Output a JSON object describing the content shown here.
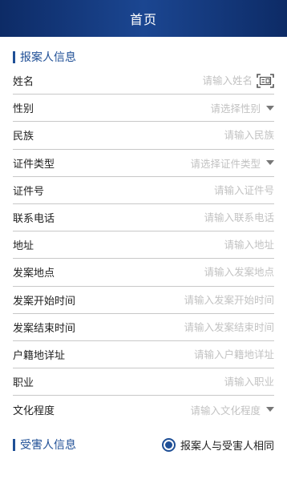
{
  "header": {
    "title": "首页"
  },
  "sections": {
    "reporter": "报案人信息",
    "victim": "受害人信息"
  },
  "fields": {
    "name": {
      "label": "姓名",
      "placeholder": "请输入姓名",
      "value": ""
    },
    "gender": {
      "label": "性别",
      "placeholder": "请选择性别"
    },
    "ethnicity": {
      "label": "民族",
      "placeholder": "请输入民族",
      "value": ""
    },
    "id_type": {
      "label": "证件类型",
      "placeholder": "请选择证件类型"
    },
    "id_number": {
      "label": "证件号",
      "placeholder": "请输入证件号",
      "value": ""
    },
    "phone": {
      "label": "联系电话",
      "placeholder": "请输入联系电话",
      "value": ""
    },
    "address": {
      "label": "地址",
      "placeholder": "请输入地址",
      "value": ""
    },
    "incident_place": {
      "label": "发案地点",
      "placeholder": "请输入发案地点",
      "value": ""
    },
    "start_time": {
      "label": "发案开始时间",
      "placeholder": "请输入发案开始时间",
      "value": ""
    },
    "end_time": {
      "label": "发案结束时间",
      "placeholder": "请输入发案结束时间",
      "value": ""
    },
    "household": {
      "label": "户籍地详址",
      "placeholder": "请输入户籍地详址",
      "value": ""
    },
    "occupation": {
      "label": "职业",
      "placeholder": "请输入职业",
      "value": ""
    },
    "education": {
      "label": "文化程度",
      "placeholder": "请输入文化程度"
    }
  },
  "same_as_reporter": {
    "label": "报案人与受害人相同",
    "checked": true
  },
  "icons": {
    "scan": "id-card-scan-icon",
    "dropdown": "caret-down-icon",
    "radio": "radio-selected-icon"
  },
  "colors": {
    "header": "#1b4691",
    "accent": "#1f4f96",
    "placeholder": "#c2c2c2",
    "divider": "#c8c8c8"
  }
}
